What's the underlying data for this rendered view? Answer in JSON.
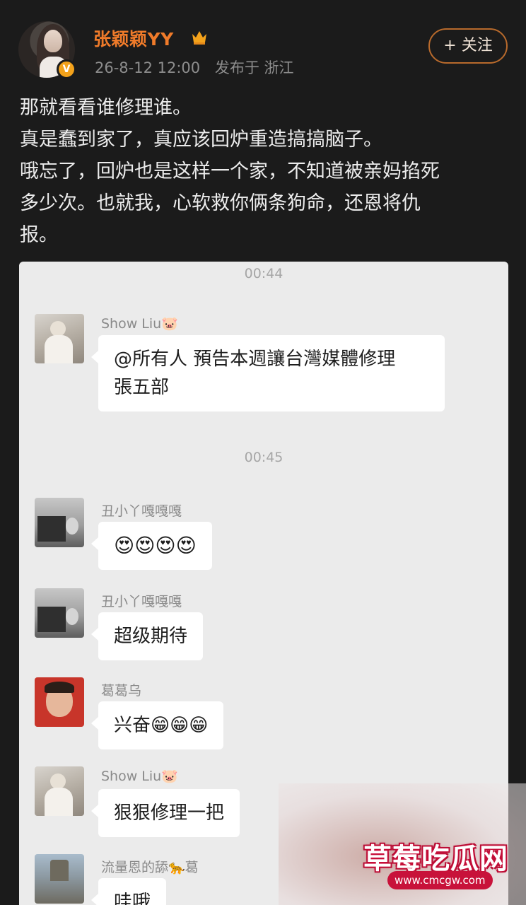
{
  "post": {
    "username": "张颖颖YY",
    "date": "26-8-12 12:00",
    "published_from": "发布于 浙江",
    "follow_label": "+ 关注",
    "verified_badge": "V",
    "member_icon": "member-crown-icon",
    "text_lines": [
      "那就看看谁修理谁。",
      "真是蠢到家了，真应该回炉重造搞搞脑子。",
      "哦忘了，回炉也是这样一个家，不知道被亲妈掐死",
      "多少次。也就我，心软救你俩条狗命，还恩将仇",
      "报。"
    ],
    "accent_color": "#f07b2a"
  },
  "chat": {
    "timestamps": [
      "00:44",
      "00:45"
    ],
    "messages": [
      {
        "sender": "Show Liu🐷",
        "lines": [
          "@所有人  預告本週讓台灣媒體修理",
          "張五部"
        ]
      },
      {
        "sender": "丑小丫嘎嘎嘎",
        "lines": [
          "😍😍😍😍"
        ]
      },
      {
        "sender": "丑小丫嘎嘎嘎",
        "lines": [
          "超级期待"
        ]
      },
      {
        "sender": "葛葛乌",
        "lines": [
          "兴奋😁😁😁"
        ]
      },
      {
        "sender": "Show Liu🐷",
        "lines": [
          "狠狠修理一把"
        ]
      },
      {
        "sender": "流量恩的舔🐆葛",
        "lines": [
          "哇哦"
        ]
      }
    ]
  },
  "watermark": {
    "title": "草莓吃瓜网",
    "url": "www.cmcgw.com"
  }
}
